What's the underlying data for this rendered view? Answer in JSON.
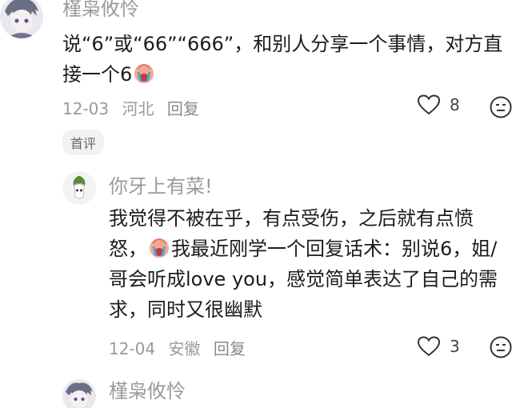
{
  "comments": [
    {
      "user": "槿枭攸怜",
      "text_pre": "说“6”或“66”“666”，和别人分享一个事情，对方直接一个6",
      "date": "12-03",
      "location": "河北",
      "reply_label": "回复",
      "likes": "8",
      "badge": "首评"
    },
    {
      "user": "你牙上有菜!",
      "text_a": "我觉得不被在乎，有点受伤，之后就有点愤怒，",
      "text_b": "我最近刚学一个回复话术：别说6，姐/哥会听成love you，感觉简单表达了自己的需求，同时又很幽默",
      "date": "12-04",
      "location": "安徽",
      "reply_label": "回复",
      "likes": "3"
    },
    {
      "user": "槿枭攸怜"
    }
  ],
  "icons": {
    "like": "heart-outline-icon",
    "reaction": "neutral-face-icon",
    "emoji": "crying-face-emoji"
  },
  "colors": {
    "meta": "#9a9a9a",
    "badge_bg": "#f2f2f2"
  }
}
